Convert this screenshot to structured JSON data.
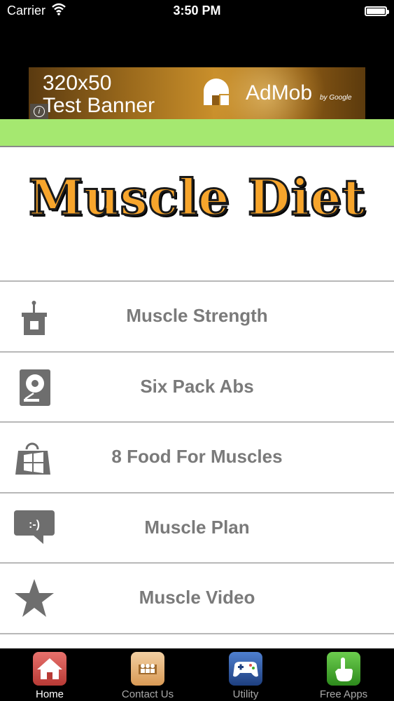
{
  "status_bar": {
    "carrier": "Carrier",
    "time": "3:50 PM"
  },
  "ad_banner": {
    "line1": "320x50",
    "line2": "Test Banner",
    "brand": "AdMob",
    "by": "by Google"
  },
  "logo": {
    "text": "Muscle Diet"
  },
  "menu": {
    "items": [
      {
        "label": "Muscle Strength",
        "icon": "podium-icon"
      },
      {
        "label": "Six Pack Abs",
        "icon": "hard-drive-icon"
      },
      {
        "label": "8 Food For Muscles",
        "icon": "store-bag-icon"
      },
      {
        "label": "Muscle Plan",
        "icon": "chat-bubble-icon"
      },
      {
        "label": "Muscle Video",
        "icon": "star-icon"
      }
    ]
  },
  "tab_bar": {
    "tabs": [
      {
        "label": "Home",
        "icon": "home-icon",
        "color": "#d9534f",
        "active": true
      },
      {
        "label": "Contact Us",
        "icon": "contacts-icon",
        "color": "#e9b77a",
        "active": false
      },
      {
        "label": "Utility",
        "icon": "gamepad-icon",
        "color": "#2f5fb0",
        "active": false
      },
      {
        "label": "Free Apps",
        "icon": "hand-pointer-icon",
        "color": "#3fae2a",
        "active": false
      }
    ]
  },
  "colors": {
    "accent_green": "#a5e870",
    "logo_orange": "#f7a52c",
    "menu_text": "#7a7a7a",
    "icon_gray": "#6e6e6e"
  }
}
